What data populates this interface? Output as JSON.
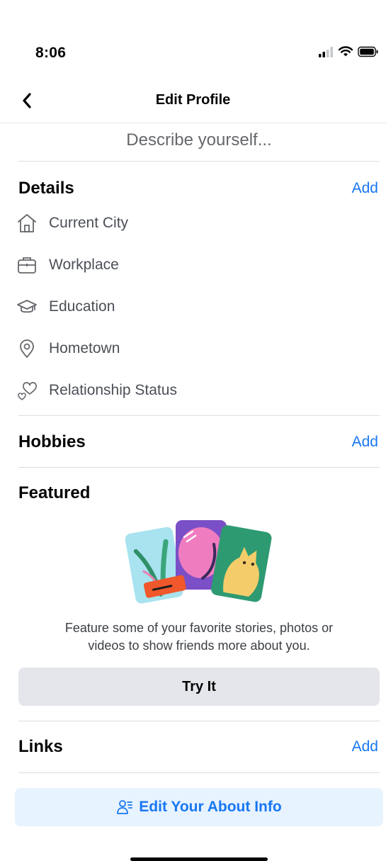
{
  "status_bar": {
    "time": "8:06"
  },
  "nav": {
    "title": "Edit Profile",
    "back_icon": "chevron-left-icon"
  },
  "bio": {
    "placeholder": "Describe yourself..."
  },
  "details": {
    "title": "Details",
    "add_label": "Add",
    "items": [
      {
        "label": "Current City",
        "icon": "house-icon"
      },
      {
        "label": "Workplace",
        "icon": "briefcase-icon"
      },
      {
        "label": "Education",
        "icon": "graduation-cap-icon"
      },
      {
        "label": "Hometown",
        "icon": "location-pin-icon"
      },
      {
        "label": "Relationship Status",
        "icon": "hearts-icon"
      }
    ]
  },
  "hobbies": {
    "title": "Hobbies",
    "add_label": "Add"
  },
  "featured": {
    "title": "Featured",
    "description_line1": "Feature some of your favorite stories, photos or",
    "description_line2": "videos to show friends more about you.",
    "button_label": "Try It"
  },
  "links": {
    "title": "Links",
    "add_label": "Add"
  },
  "edit_about": {
    "label": "Edit Your About Info",
    "icon": "person-list-icon"
  },
  "colors": {
    "accent": "#1877f2",
    "button_gray": "#e4e6eb",
    "button_blue_bg": "#e7f3ff",
    "text_secondary": "#65676b"
  }
}
